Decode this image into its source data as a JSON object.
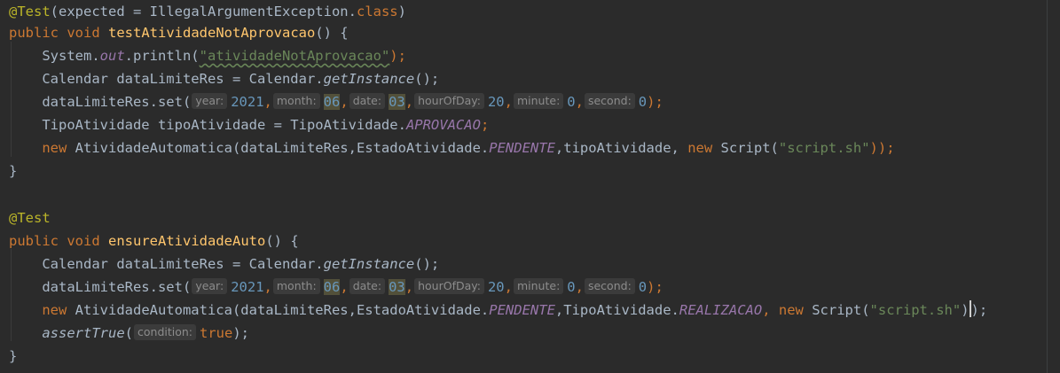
{
  "code": {
    "l1": {
      "ann": "@Test",
      "open": "(",
      "key": "expected",
      "eq": " = ",
      "cls": "IllegalArgumentException",
      "dot": ".",
      "kw": "class",
      "close": ")"
    },
    "l2": {
      "public": "public",
      "void": "void",
      "method": "testAtividadeNotAprovacao",
      "rest": "() {"
    },
    "l3": {
      "obj": "System.",
      "field": "out",
      "call": ".println(",
      "str": "\"atividadeNotAprovacao\"",
      "end": ");"
    },
    "l4": {
      "decl": "Calendar dataLimiteRes = Calendar.",
      "call": "getInstance",
      "end": "();"
    },
    "l5": {
      "call": "dataLimiteRes.set(",
      "hint_year": "year:",
      "year": "2021",
      "hint_month": "month:",
      "month": "06",
      "hint_date": "date:",
      "date": "03",
      "hint_hour": "hourOfDay:",
      "hour": "20",
      "hint_minute": "minute:",
      "minute": "0",
      "hint_second": "second:",
      "second": "0",
      "end": ");"
    },
    "l6": {
      "decl": "TipoAtividade tipoAtividade = TipoAtividade.",
      "const": "APROVACAO",
      "end": ";"
    },
    "l7": {
      "new": "new",
      "ctor": " AtividadeAutomatica(dataLimiteRes,EstadoAtividade.",
      "const": "PENDENTE",
      "arg": ",tipoAtividade, ",
      "new2": "new",
      "script": " Script(",
      "str": "\"script.sh\"",
      "end": "));"
    },
    "l8": {
      "brace": "}"
    },
    "l10": {
      "ann": "@Test"
    },
    "l11": {
      "public": "public",
      "void": "void",
      "method": "ensureAtividadeAuto",
      "rest": "() {"
    },
    "l12": {
      "decl": "Calendar dataLimiteRes = Calendar.",
      "call": "getInstance",
      "end": "();"
    },
    "l13": {
      "call": "dataLimiteRes.set(",
      "hint_year": "year:",
      "year": "2021",
      "hint_month": "month:",
      "month": "06",
      "hint_date": "date:",
      "date": "03",
      "hint_hour": "hourOfDay:",
      "hour": "20",
      "hint_minute": "minute:",
      "minute": "0",
      "hint_second": "second:",
      "second": "0",
      "end": ");"
    },
    "l14": {
      "new": "new",
      "ctor": " AtividadeAutomatica(dataLimiteRes,EstadoAtividade.",
      "const": "PENDENTE",
      "arg": ",TipoAtividade.",
      "const2": "REALIZACAO",
      "sep": ", ",
      "new2": "new",
      "script": " Script(",
      "str": "\"script.sh\"",
      "end_a": ")",
      "end_b": ");"
    },
    "l15": {
      "call": "assertTrue",
      "open": "(",
      "hint": "condition:",
      "val": "true",
      "end": ");"
    },
    "l16": {
      "brace": "}"
    }
  },
  "colors": {
    "background": "#2b2b2b",
    "annotation": "#bbb529",
    "keyword": "#cc7832",
    "method": "#ffc66d",
    "string": "#6a8759",
    "number": "#6897bb",
    "static": "#9876aa",
    "text": "#a9b7c6"
  }
}
